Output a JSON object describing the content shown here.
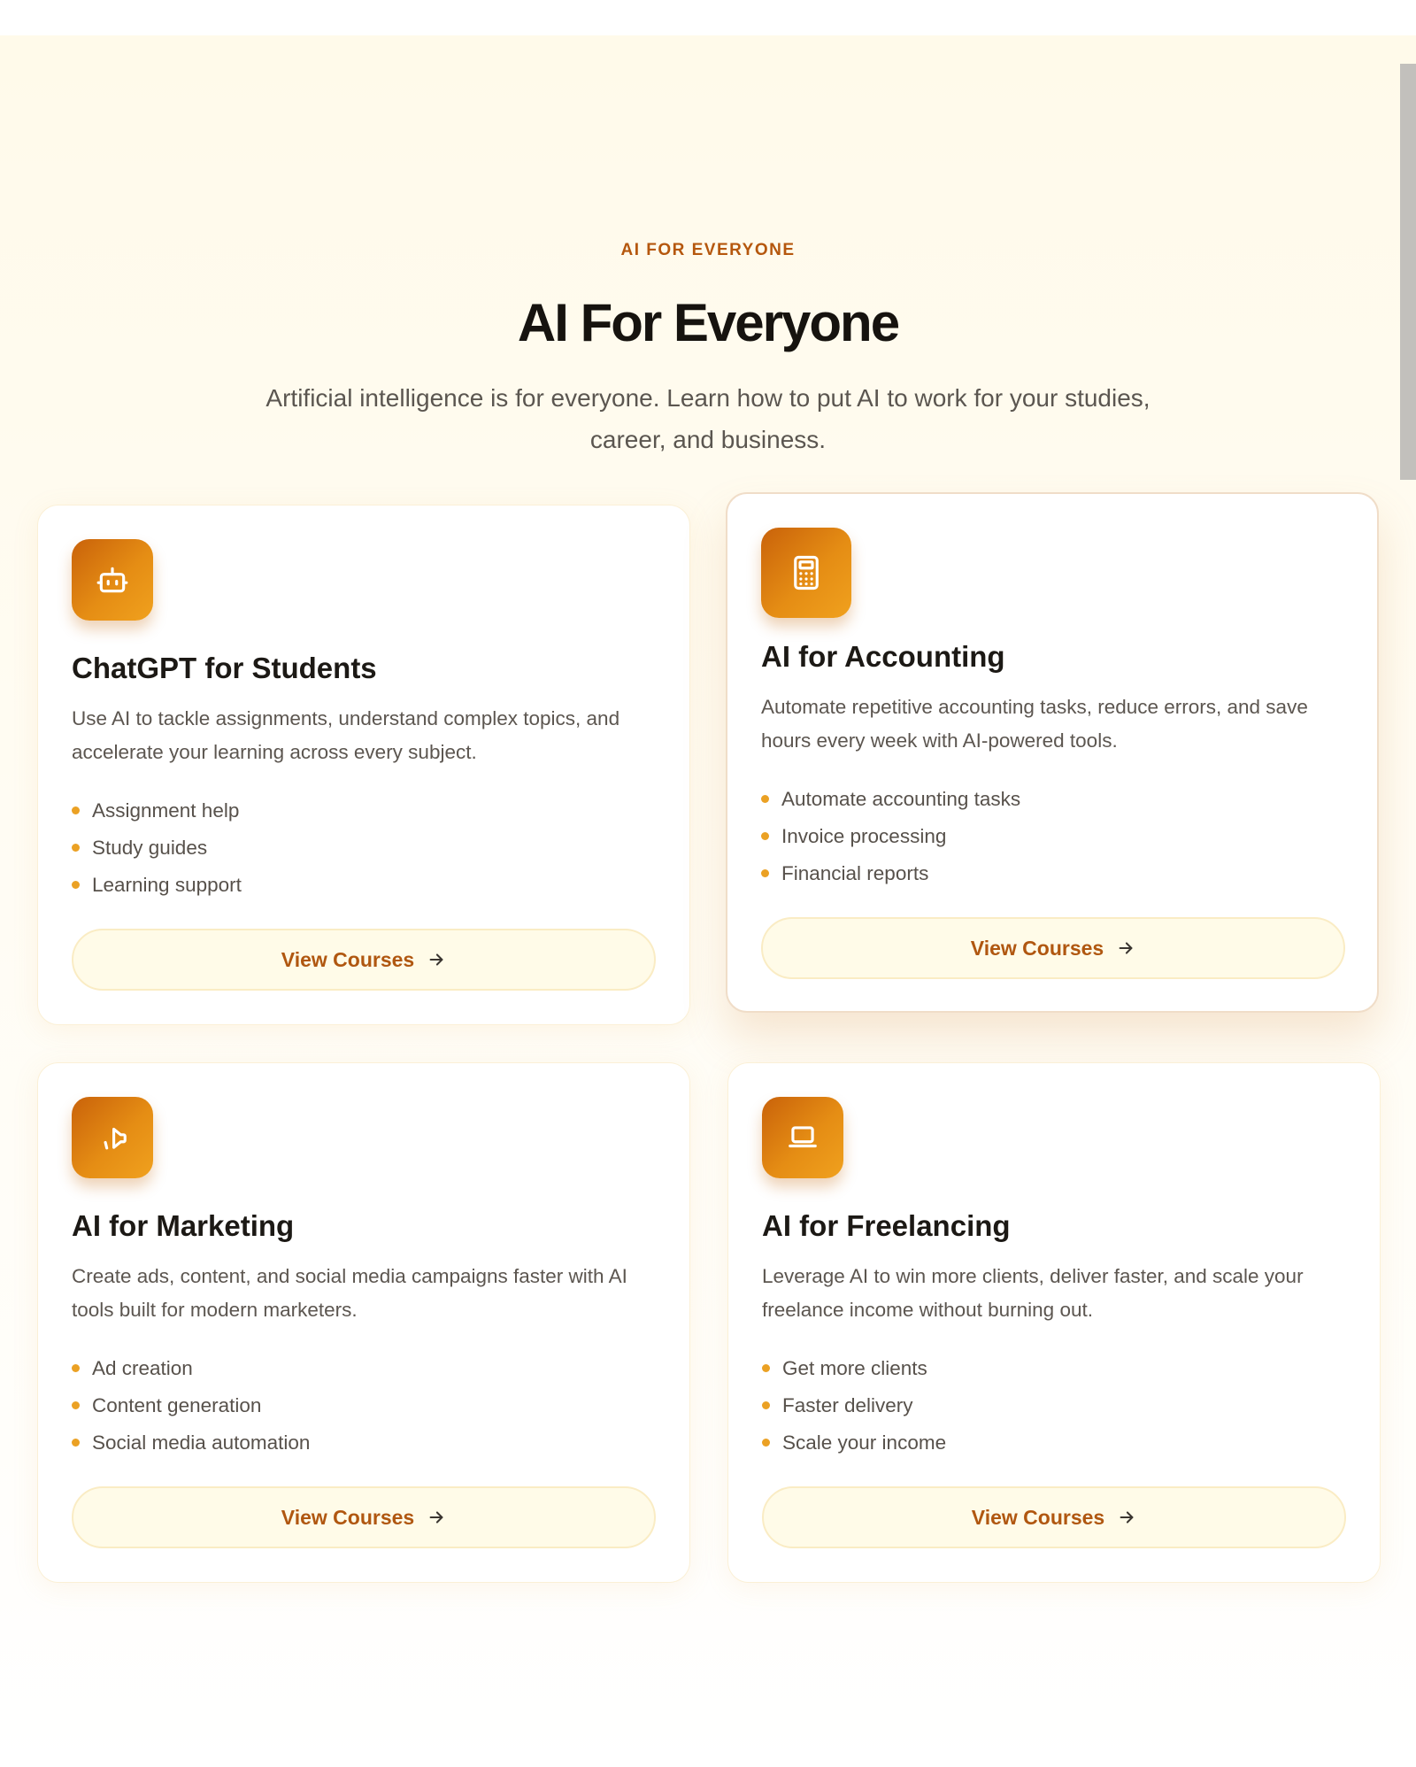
{
  "header": {
    "eyebrow": "AI FOR EVERYONE",
    "title": "AI For Everyone",
    "subtitle": "Artificial intelligence is for everyone. Learn how to put AI to work for your studies, career, and business."
  },
  "theme": {
    "accent": "#b5570d",
    "icon_gradient_start": "#c9620a",
    "icon_gradient_end": "#f0a11e",
    "bullet": "#eba124",
    "button_bg": "#fffbe8"
  },
  "cards": [
    {
      "icon": "robot-icon",
      "title": "ChatGPT for Students",
      "description": "Use AI to tackle assignments, understand complex topics, and accelerate your learning across every subject.",
      "features": [
        "Assignment help",
        "Study guides",
        "Learning support"
      ],
      "button_label": "View Courses"
    },
    {
      "icon": "calculator-icon",
      "title": "AI for Accounting",
      "description": "Automate repetitive accounting tasks, reduce errors, and save hours every week with AI-powered tools.",
      "features": [
        "Automate accounting tasks",
        "Invoice processing",
        "Financial reports"
      ],
      "button_label": "View Courses"
    },
    {
      "icon": "megaphone-icon",
      "title": "AI for Marketing",
      "description": "Create ads, content, and social media campaigns faster with AI tools built for modern marketers.",
      "features": [
        "Ad creation",
        "Content generation",
        "Social media automation"
      ],
      "button_label": "View Courses"
    },
    {
      "icon": "laptop-icon",
      "title": "AI for Freelancing",
      "description": "Leverage AI to win more clients, deliver faster, and scale your freelance income without burning out.",
      "features": [
        "Get more clients",
        "Faster delivery",
        "Scale your income"
      ],
      "button_label": "View Courses"
    }
  ]
}
